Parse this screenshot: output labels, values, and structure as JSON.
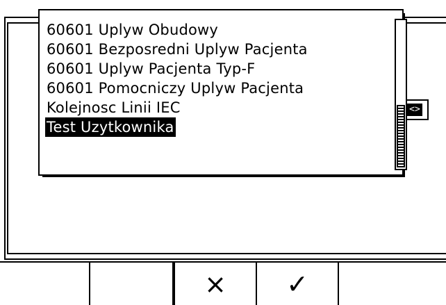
{
  "list": {
    "items": [
      {
        "label": "60601 Uplyw Obudowy",
        "selected": false
      },
      {
        "label": "60601 Bezposredni Uplyw Pacjenta",
        "selected": false
      },
      {
        "label": "60601 Uplyw Pacjenta Typ-F",
        "selected": false
      },
      {
        "label": "60601 Pomocniczy Uplyw Pacjenta",
        "selected": false
      },
      {
        "label": "Kolejnosc Linii IEC",
        "selected": false
      },
      {
        "label": "Test Uzytkownika",
        "selected": true
      }
    ]
  },
  "side_arrow": {
    "label": "<>"
  },
  "softkeys": {
    "cancel": {
      "label": "×",
      "icon": "cross-icon"
    },
    "confirm": {
      "label": "✓",
      "icon": "check-icon"
    }
  },
  "colors": {
    "foreground": "#000000",
    "background": "#ffffff"
  }
}
